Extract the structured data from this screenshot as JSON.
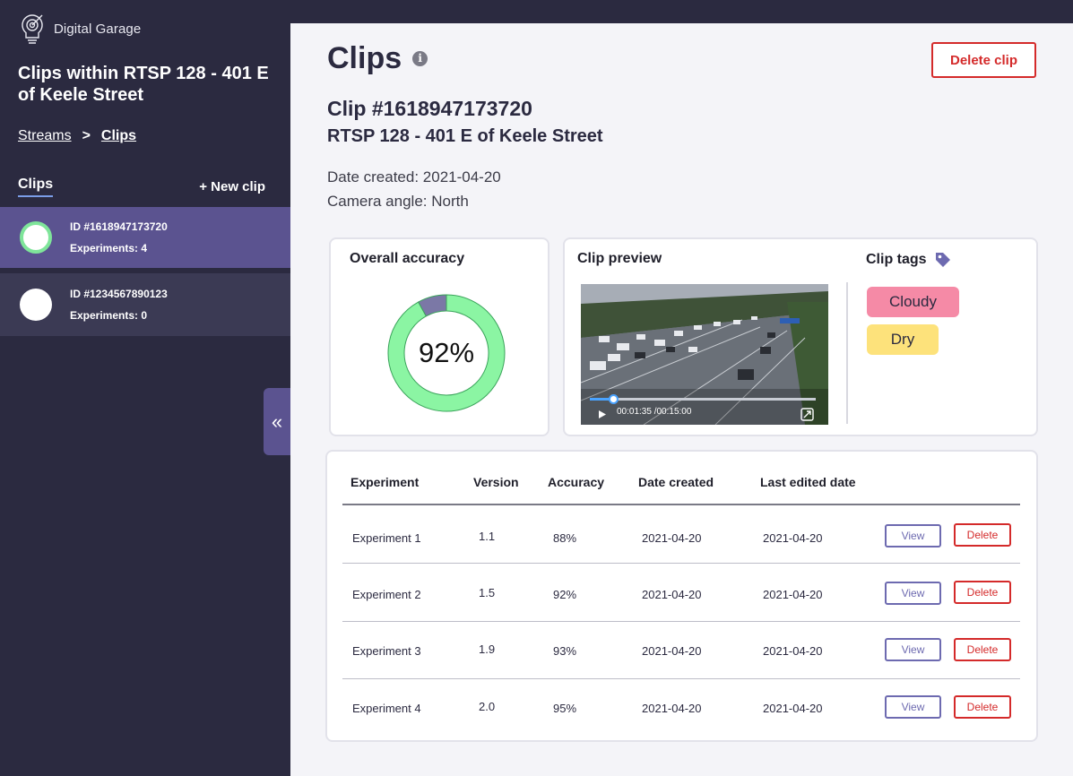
{
  "brand": {
    "name": "Digital Garage",
    "logo_icon": "lightbulb-target-icon"
  },
  "sidebar": {
    "title": "Clips within RTSP 128 - 401 E of Keele Street",
    "breadcrumb": {
      "parent": "Streams",
      "separator": ">",
      "current": "Clips"
    },
    "clips_label": "Clips",
    "new_clip": "+ New clip",
    "items": [
      {
        "id": "ID #1618947173720",
        "experiments": "Experiments: 4",
        "active": true
      },
      {
        "id": "ID #1234567890123",
        "experiments": "Experiments: 0",
        "active": false
      }
    ],
    "collapse_icon": "double-chevron-left-icon"
  },
  "main": {
    "page_title": "Clips",
    "delete_clip": "Delete clip",
    "clip_heading": "Clip #1618947173720",
    "clip_stream": "RTSP 128 - 401 E of Keele Street",
    "date_created": "Date created: 2021-04-20",
    "camera_angle": "Camera angle: North",
    "accuracy_card": {
      "title": "Overall accuracy",
      "value": "92%",
      "fraction": 0.92,
      "fill_color": "#8bf5a3",
      "rest_color": "#7b78a6"
    },
    "preview_card": {
      "title": "Clip preview",
      "time": "00:01:35 /00:15:00",
      "progress": 0.105
    },
    "tags_card": {
      "title": "Clip tags",
      "tags": [
        "Cloudy",
        "Dry"
      ]
    },
    "table": {
      "headers": [
        "Experiment",
        "Version",
        "Accuracy",
        "Date created",
        "Last edited date"
      ],
      "view_label": "View",
      "delete_label": "Delete",
      "rows": [
        {
          "experiment": "Experiment 1",
          "version": "1.1",
          "accuracy": "88%",
          "created": "2021-04-20",
          "edited": "2021-04-20"
        },
        {
          "experiment": "Experiment 2",
          "version": "1.5",
          "accuracy": "92%",
          "created": "2021-04-20",
          "edited": "2021-04-20"
        },
        {
          "experiment": "Experiment 3",
          "version": "1.9",
          "accuracy": "93%",
          "created": "2021-04-20",
          "edited": "2021-04-20"
        },
        {
          "experiment": "Experiment 4",
          "version": "2.0",
          "accuracy": "95%",
          "created": "2021-04-20",
          "edited": "2021-04-20"
        }
      ]
    }
  }
}
